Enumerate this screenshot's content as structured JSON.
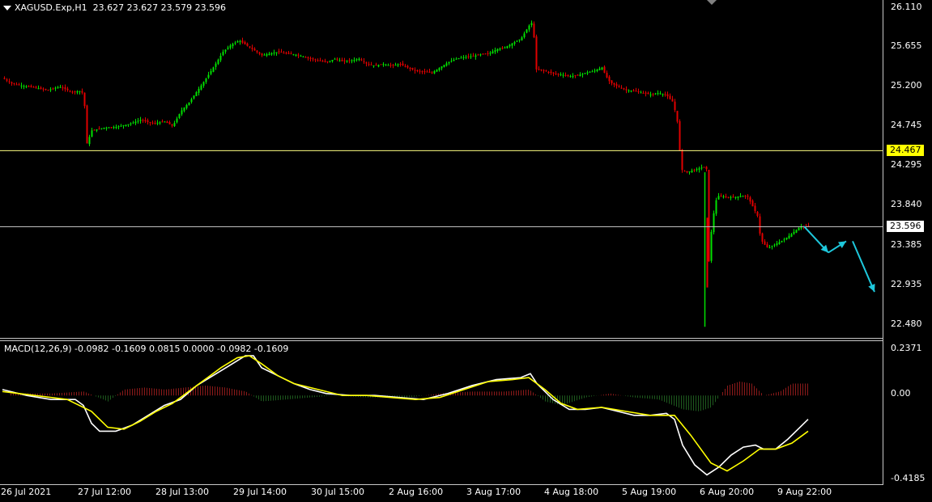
{
  "header": {
    "symbol": "XAGUSD.Exp,H1",
    "ohlc": "23.627 23.627 23.579 23.596"
  },
  "macd_header": "MACD(12,26,9) -0.0982 -0.1609 0.0815 0.0000 -0.0982 -0.1609",
  "price_axis": [
    "26.110",
    "25.655",
    "25.200",
    "24.745",
    "24.295",
    "23.840",
    "23.385",
    "22.935",
    "22.480"
  ],
  "price_tags": {
    "level": "24.467",
    "last": "23.596"
  },
  "macd_axis": [
    "0.2371",
    "0.00",
    "-0.4185"
  ],
  "time_axis": [
    "26 Jul 2021",
    "27 Jul 12:00",
    "28 Jul 13:00",
    "29 Jul 14:00",
    "30 Jul 15:00",
    "2 Aug 16:00",
    "3 Aug 17:00",
    "4 Aug 18:00",
    "5 Aug 19:00",
    "6 Aug 20:00",
    "9 Aug 22:00"
  ],
  "colors": {
    "background": "#000000",
    "bull_candle": "#00e000",
    "bear_candle": "#e00000",
    "horizontal_level": "#ffff80",
    "last_price_line": "#c0c0c0",
    "arrow": "#1ec8dc",
    "macd_line": "#ffffff",
    "signal_line": "#ffff00",
    "hist_pos": "#8b1a1a",
    "hist_neg": "#1e5a1e"
  },
  "chart_data": {
    "type": "candlestick",
    "symbol": "XAGUSD.Exp",
    "timeframe": "H1",
    "ylim": [
      22.4,
      26.13
    ],
    "horizontal_level": 24.467,
    "last_price": 23.596,
    "close_path": [
      [
        0,
        25.3
      ],
      [
        10,
        25.24
      ],
      [
        25,
        25.21
      ],
      [
        40,
        25.19
      ],
      [
        55,
        25.16
      ],
      [
        70,
        25.2
      ],
      [
        85,
        25.14
      ],
      [
        95,
        25.15
      ],
      [
        100,
        25.12
      ],
      [
        104,
        24.55
      ],
      [
        110,
        24.7
      ],
      [
        125,
        24.73
      ],
      [
        140,
        24.74
      ],
      [
        155,
        24.77
      ],
      [
        170,
        24.82
      ],
      [
        185,
        24.78
      ],
      [
        200,
        24.8
      ],
      [
        210,
        24.75
      ],
      [
        220,
        24.92
      ],
      [
        230,
        25.02
      ],
      [
        240,
        25.15
      ],
      [
        250,
        25.28
      ],
      [
        262,
        25.45
      ],
      [
        272,
        25.6
      ],
      [
        282,
        25.68
      ],
      [
        292,
        25.73
      ],
      [
        300,
        25.68
      ],
      [
        310,
        25.62
      ],
      [
        320,
        25.56
      ],
      [
        330,
        25.58
      ],
      [
        340,
        25.6
      ],
      [
        350,
        25.58
      ],
      [
        360,
        25.57
      ],
      [
        370,
        25.55
      ],
      [
        380,
        25.52
      ],
      [
        390,
        25.5
      ],
      [
        400,
        25.48
      ],
      [
        410,
        25.52
      ],
      [
        420,
        25.49
      ],
      [
        430,
        25.5
      ],
      [
        440,
        25.52
      ],
      [
        450,
        25.46
      ],
      [
        460,
        25.44
      ],
      [
        470,
        25.46
      ],
      [
        480,
        25.44
      ],
      [
        490,
        25.46
      ],
      [
        500,
        25.42
      ],
      [
        510,
        25.38
      ],
      [
        520,
        25.37
      ],
      [
        530,
        25.36
      ],
      [
        540,
        25.42
      ],
      [
        550,
        25.48
      ],
      [
        560,
        25.52
      ],
      [
        570,
        25.54
      ],
      [
        580,
        25.55
      ],
      [
        590,
        25.57
      ],
      [
        600,
        25.58
      ],
      [
        610,
        25.63
      ],
      [
        620,
        25.65
      ],
      [
        630,
        25.7
      ],
      [
        640,
        25.75
      ],
      [
        650,
        25.9
      ],
      [
        655,
        25.95
      ],
      [
        658,
        25.4
      ],
      [
        670,
        25.38
      ],
      [
        680,
        25.35
      ],
      [
        690,
        25.34
      ],
      [
        700,
        25.32
      ],
      [
        710,
        25.33
      ],
      [
        720,
        25.36
      ],
      [
        730,
        25.38
      ],
      [
        740,
        25.42
      ],
      [
        745,
        25.32
      ],
      [
        750,
        25.25
      ],
      [
        760,
        25.2
      ],
      [
        770,
        25.16
      ],
      [
        780,
        25.15
      ],
      [
        790,
        25.13
      ],
      [
        800,
        25.11
      ],
      [
        810,
        25.13
      ],
      [
        820,
        25.1
      ],
      [
        828,
        25.02
      ],
      [
        833,
        24.8
      ],
      [
        838,
        24.25
      ],
      [
        845,
        24.22
      ],
      [
        855,
        24.25
      ],
      [
        865,
        24.28
      ],
      [
        870,
        24.25
      ],
      [
        872,
        23.2
      ],
      [
        876,
        23.65
      ],
      [
        882,
        23.95
      ],
      [
        892,
        23.94
      ],
      [
        902,
        23.93
      ],
      [
        912,
        23.95
      ],
      [
        920,
        23.94
      ],
      [
        926,
        23.83
      ],
      [
        932,
        23.72
      ],
      [
        936,
        23.45
      ],
      [
        940,
        23.4
      ],
      [
        945,
        23.35
      ],
      [
        955,
        23.4
      ],
      [
        965,
        23.45
      ],
      [
        975,
        23.52
      ],
      [
        985,
        23.6
      ],
      [
        995,
        23.6
      ]
    ],
    "projection_arrows": [
      {
        "from": [
          990,
          23.6
        ],
        "to": [
          1020,
          23.3
        ]
      },
      {
        "from": [
          1020,
          23.3
        ],
        "to": [
          1042,
          23.43
        ]
      },
      {
        "from": [
          1050,
          23.43
        ],
        "to": [
          1077,
          22.85
        ]
      }
    ],
    "macd": {
      "ylim": [
        -0.4185,
        0.2371
      ],
      "macd_line": [
        [
          0,
          0.03
        ],
        [
          30,
          0.0
        ],
        [
          60,
          -0.02
        ],
        [
          90,
          -0.02
        ],
        [
          100,
          -0.05
        ],
        [
          110,
          -0.14
        ],
        [
          120,
          -0.18
        ],
        [
          140,
          -0.18
        ],
        [
          160,
          -0.15
        ],
        [
          180,
          -0.1
        ],
        [
          200,
          -0.05
        ],
        [
          220,
          -0.02
        ],
        [
          240,
          0.05
        ],
        [
          260,
          0.1
        ],
        [
          280,
          0.15
        ],
        [
          300,
          0.2
        ],
        [
          310,
          0.2
        ],
        [
          320,
          0.14
        ],
        [
          340,
          0.1
        ],
        [
          360,
          0.06
        ],
        [
          380,
          0.03
        ],
        [
          400,
          0.01
        ],
        [
          430,
          0.0
        ],
        [
          460,
          0.0
        ],
        [
          490,
          -0.01
        ],
        [
          520,
          -0.02
        ],
        [
          550,
          0.01
        ],
        [
          580,
          0.05
        ],
        [
          610,
          0.08
        ],
        [
          640,
          0.09
        ],
        [
          652,
          0.11
        ],
        [
          660,
          0.06
        ],
        [
          680,
          -0.02
        ],
        [
          700,
          -0.07
        ],
        [
          720,
          -0.07
        ],
        [
          740,
          -0.06
        ],
        [
          760,
          -0.08
        ],
        [
          780,
          -0.1
        ],
        [
          800,
          -0.1
        ],
        [
          820,
          -0.09
        ],
        [
          830,
          -0.12
        ],
        [
          840,
          -0.25
        ],
        [
          855,
          -0.35
        ],
        [
          870,
          -0.4
        ],
        [
          885,
          -0.36
        ],
        [
          900,
          -0.3
        ],
        [
          915,
          -0.26
        ],
        [
          930,
          -0.25
        ],
        [
          940,
          -0.27
        ],
        [
          955,
          -0.27
        ],
        [
          970,
          -0.22
        ],
        [
          985,
          -0.16
        ],
        [
          995,
          -0.12
        ]
      ],
      "signal_line": [
        [
          0,
          0.02
        ],
        [
          40,
          0.0
        ],
        [
          80,
          -0.02
        ],
        [
          110,
          -0.08
        ],
        [
          130,
          -0.16
        ],
        [
          150,
          -0.17
        ],
        [
          170,
          -0.13
        ],
        [
          190,
          -0.08
        ],
        [
          210,
          -0.04
        ],
        [
          230,
          0.02
        ],
        [
          250,
          0.08
        ],
        [
          270,
          0.14
        ],
        [
          290,
          0.19
        ],
        [
          305,
          0.2
        ],
        [
          320,
          0.16
        ],
        [
          340,
          0.1
        ],
        [
          360,
          0.06
        ],
        [
          390,
          0.03
        ],
        [
          420,
          0.0
        ],
        [
          450,
          0.0
        ],
        [
          480,
          -0.01
        ],
        [
          510,
          -0.02
        ],
        [
          540,
          -0.01
        ],
        [
          570,
          0.03
        ],
        [
          600,
          0.07
        ],
        [
          630,
          0.08
        ],
        [
          650,
          0.09
        ],
        [
          670,
          0.03
        ],
        [
          690,
          -0.04
        ],
        [
          710,
          -0.07
        ],
        [
          740,
          -0.06
        ],
        [
          770,
          -0.08
        ],
        [
          800,
          -0.1
        ],
        [
          830,
          -0.1
        ],
        [
          850,
          -0.2
        ],
        [
          875,
          -0.34
        ],
        [
          895,
          -0.38
        ],
        [
          915,
          -0.33
        ],
        [
          935,
          -0.27
        ],
        [
          955,
          -0.27
        ],
        [
          975,
          -0.24
        ],
        [
          995,
          -0.18
        ]
      ],
      "histogram": [
        [
          10,
          0.01
        ],
        [
          60,
          0.01
        ],
        [
          100,
          0.02
        ],
        [
          130,
          -0.03
        ],
        [
          150,
          0.03
        ],
        [
          175,
          0.04
        ],
        [
          200,
          0.03
        ],
        [
          225,
          0.04
        ],
        [
          250,
          0.05
        ],
        [
          275,
          0.04
        ],
        [
          300,
          0.02
        ],
        [
          320,
          -0.03
        ],
        [
          350,
          -0.02
        ],
        [
          380,
          -0.01
        ],
        [
          410,
          0.0
        ],
        [
          450,
          -0.01
        ],
        [
          500,
          -0.01
        ],
        [
          540,
          0.01
        ],
        [
          580,
          0.02
        ],
        [
          620,
          0.02
        ],
        [
          650,
          0.03
        ],
        [
          670,
          -0.03
        ],
        [
          690,
          -0.05
        ],
        [
          720,
          -0.01
        ],
        [
          750,
          0.01
        ],
        [
          780,
          -0.01
        ],
        [
          810,
          -0.02
        ],
        [
          840,
          -0.07
        ],
        [
          860,
          -0.08
        ],
        [
          875,
          -0.06
        ],
        [
          895,
          0.05
        ],
        [
          910,
          0.07
        ],
        [
          925,
          0.06
        ],
        [
          940,
          0.0
        ],
        [
          960,
          0.02
        ],
        [
          975,
          0.06
        ],
        [
          990,
          0.06
        ]
      ]
    }
  }
}
